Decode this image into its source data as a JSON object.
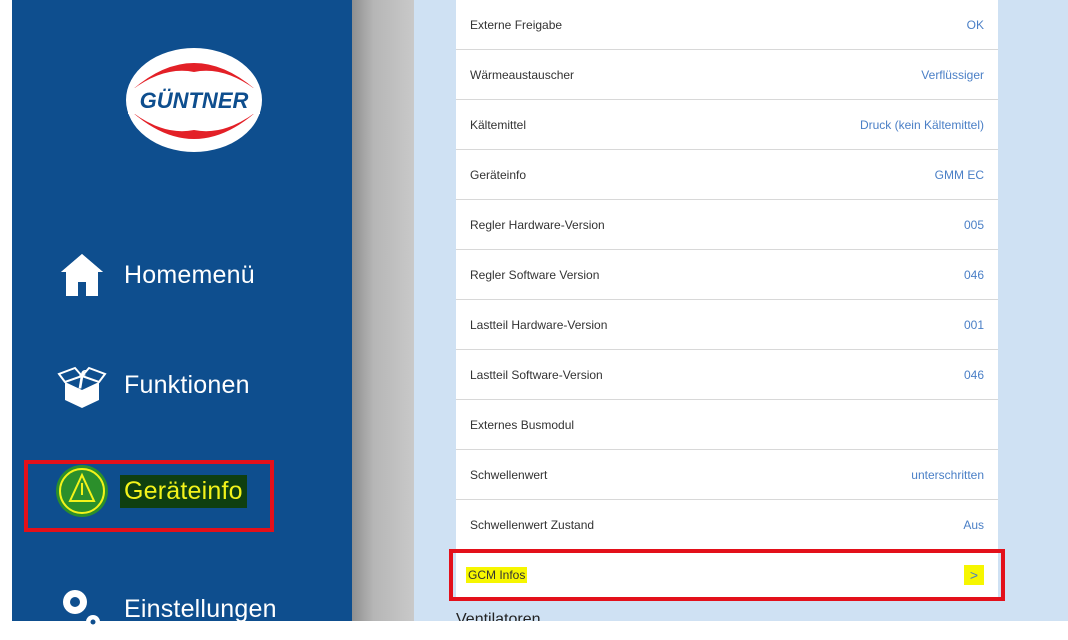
{
  "sidebar": {
    "logo_text": "GÜNTNER",
    "items": [
      {
        "label": "Homemenü",
        "icon": "home-icon"
      },
      {
        "label": "Funktionen",
        "icon": "functions-box-icon"
      },
      {
        "label": "Geräteinfo",
        "icon": "device-info-icon"
      },
      {
        "label": "Einstellungen",
        "icon": "gear-icon"
      }
    ],
    "selected": "Geräteinfo"
  },
  "list": {
    "rows": [
      {
        "label": "Externe Freigabe",
        "value": "OK"
      },
      {
        "label": "Wärmeaustauscher",
        "value": "Verflüssiger"
      },
      {
        "label": "Kältemittel",
        "value": "Druck (kein Kältemittel)"
      },
      {
        "label": "Geräteinfo",
        "value": "GMM EC"
      },
      {
        "label": "Regler Hardware-Version",
        "value": "005"
      },
      {
        "label": "Regler Software Version",
        "value": "046"
      },
      {
        "label": "Lastteil Hardware-Version",
        "value": "001"
      },
      {
        "label": "Lastteil Software-Version",
        "value": "046"
      },
      {
        "label": "Externes Busmodul",
        "value": ""
      },
      {
        "label": "Schwellenwert",
        "value": "unterschritten"
      },
      {
        "label": "Schwellenwert Zustand",
        "value": "Aus"
      },
      {
        "label": "GCM Infos",
        "value": ">"
      }
    ]
  },
  "section": {
    "title": "Ventilatoren"
  },
  "colors": {
    "sidebar": "#0e4e8e",
    "highlight": "#e3101a",
    "accent": "#f6f600",
    "value_text": "#4a7fc6"
  }
}
